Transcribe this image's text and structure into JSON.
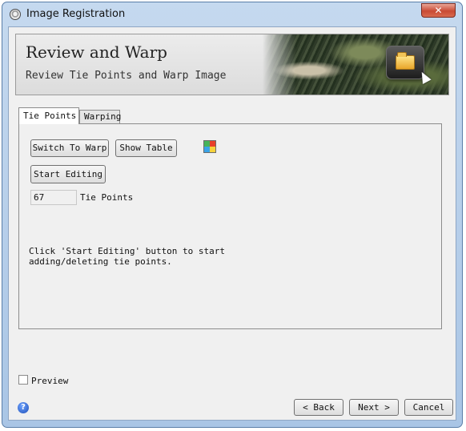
{
  "window": {
    "title": "Image Registration",
    "close_glyph": "✕"
  },
  "header": {
    "title": "Review and Warp",
    "subtitle": "Review Tie Points and Warp Image",
    "icon": "folder-icon"
  },
  "tabs": [
    {
      "label": "Tie Points",
      "active": true
    },
    {
      "label": "Warping",
      "active": false
    }
  ],
  "tie_points_tab": {
    "switch_label": "Switch To Warp",
    "show_table_label": "Show Table",
    "start_editing_label": "Start Editing",
    "tie_point_count": "67",
    "tie_points_label": "Tie Points",
    "message": "Click 'Start Editing' button to start\nadding/deleting tie points."
  },
  "footer": {
    "preview_label": "Preview",
    "preview_checked": false,
    "help_glyph": "?",
    "back_label": "< Back",
    "next_label": "Next >",
    "cancel_label": "Cancel"
  },
  "colors": {
    "frame": "#a9c5e5",
    "close": "#c94a34",
    "help": "#1f4fb8"
  }
}
